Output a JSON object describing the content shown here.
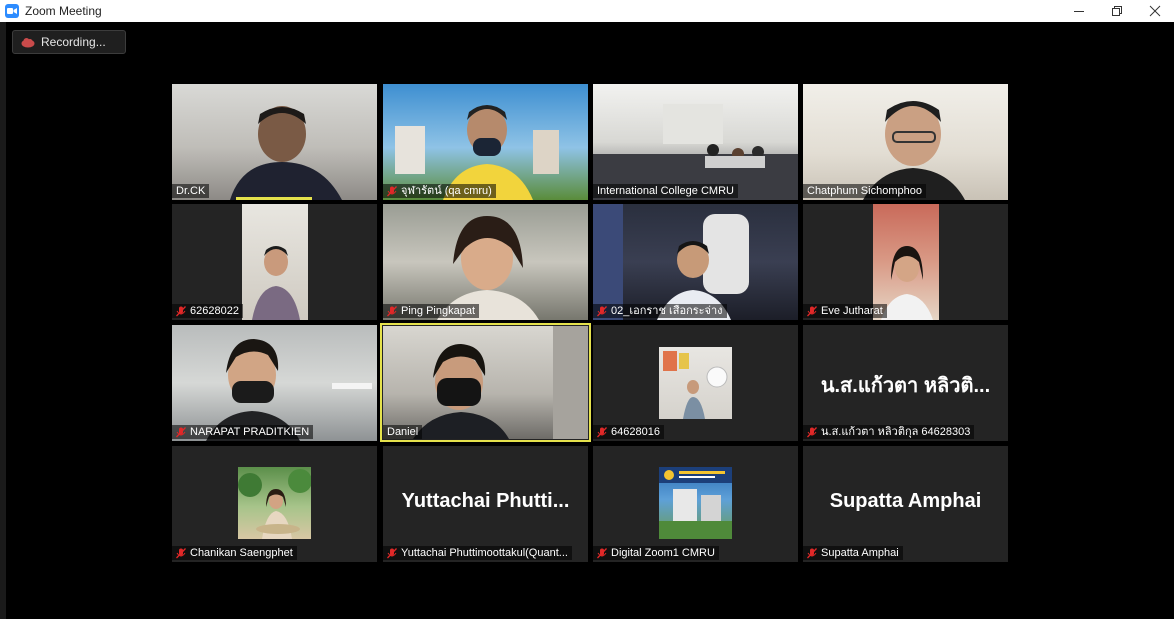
{
  "window": {
    "title": "Zoom Meeting"
  },
  "recording": {
    "label": "Recording..."
  },
  "tiles": [
    {
      "name": "Dr.CK",
      "muted": false
    },
    {
      "name": "จุฬารัตน์ (qa cmru)",
      "muted": true
    },
    {
      "name": "International College CMRU",
      "muted": false
    },
    {
      "name": "Chatphum Sichomphoo",
      "muted": false
    },
    {
      "name": "62628022",
      "muted": true
    },
    {
      "name": "Ping Pingkapat",
      "muted": true
    },
    {
      "name": "02_เอกราช เสือกระจ่าง",
      "muted": true
    },
    {
      "name": "Eve Jutharat",
      "muted": true
    },
    {
      "name": "NARAPAT PRADITKIEN",
      "muted": true
    },
    {
      "name": "Daniel",
      "muted": false
    },
    {
      "name": "64628016",
      "muted": true
    },
    {
      "name": "น.ส.แก้วตา หลิวติกุล 64628303",
      "muted": true,
      "display_name": "น.ส.แก้วตา หลิวติ..."
    },
    {
      "name": "Chanikan Saengphet",
      "muted": true
    },
    {
      "name": "Yuttachai Phuttimoottakul(Quant...",
      "muted": true,
      "display_name": "Yuttachai  Phutti..."
    },
    {
      "name": "Digital Zoom1 CMRU",
      "muted": true
    },
    {
      "name": "Supatta Amphai",
      "muted": true,
      "display_name": "Supatta Amphai"
    }
  ],
  "colors": {
    "active_speaker": "#e5e24c",
    "muted_icon": "#e02828",
    "zoom_blue": "#2d8cff"
  }
}
